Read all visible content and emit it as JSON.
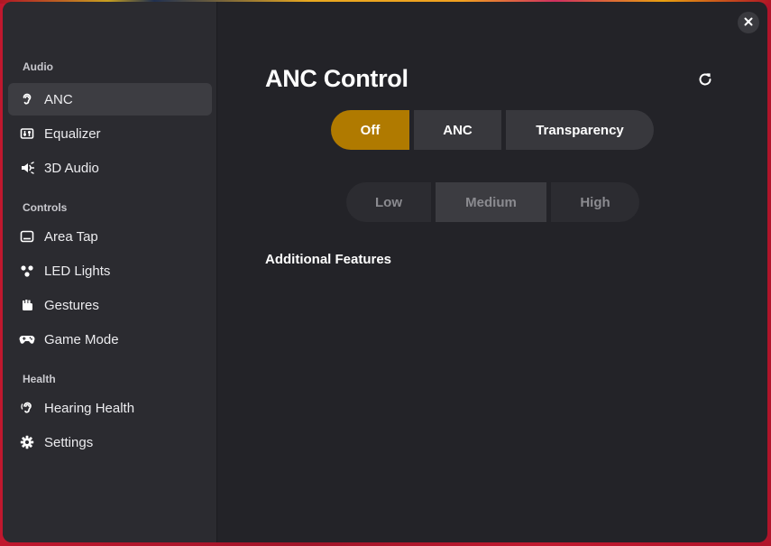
{
  "window": {
    "close_icon": "close-icon"
  },
  "sidebar": {
    "sections": [
      {
        "label": "Audio"
      },
      {
        "label": "Controls"
      },
      {
        "label": "Health"
      }
    ],
    "items": [
      {
        "label": "ANC",
        "icon": "ear-icon",
        "active": true
      },
      {
        "label": "Equalizer",
        "icon": "equalizer-icon"
      },
      {
        "label": "3D Audio",
        "icon": "speaker-wave-icon"
      },
      {
        "label": "Area Tap",
        "icon": "touch-area-icon"
      },
      {
        "label": "LED Lights",
        "icon": "led-lights-icon"
      },
      {
        "label": "Gestures",
        "icon": "gestures-icon"
      },
      {
        "label": "Game Mode",
        "icon": "gamepad-icon"
      },
      {
        "label": "Hearing Health",
        "icon": "hearing-icon"
      },
      {
        "label": "Settings",
        "icon": "gear-icon"
      }
    ]
  },
  "main": {
    "title": "ANC Control",
    "refresh_icon": "refresh-icon",
    "mode_options": [
      "Off",
      "ANC",
      "Transparency"
    ],
    "mode_selected": "Off",
    "level_options": [
      "Low",
      "Medium",
      "High"
    ],
    "level_selected": "Medium",
    "additional_features_heading": "Additional Features"
  },
  "colors": {
    "accent": "#b07a00",
    "sidebar_bg": "#2b2b30",
    "main_bg": "#232328",
    "active_item_bg": "#3d3d42"
  }
}
